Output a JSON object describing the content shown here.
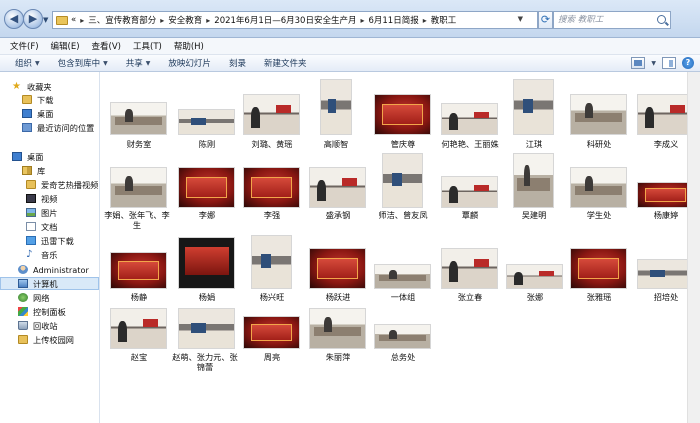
{
  "address": {
    "crumbs": [
      "«",
      "三、宣传教育部分",
      "安全教育",
      "2021年6月1日—6月30日安全生产月",
      "6月11日简报",
      "教职工"
    ]
  },
  "search": {
    "placeholder": "搜索 教职工"
  },
  "menu": [
    "文件(F)",
    "编辑(E)",
    "查看(V)",
    "工具(T)",
    "帮助(H)"
  ],
  "toolbar": {
    "organize": "组织",
    "include": "包含到库中",
    "share": "共享",
    "slideshow": "放映幻灯片",
    "burn": "刻录",
    "new_folder": "新建文件夹"
  },
  "nav": [
    {
      "label": "收藏夹",
      "icon": "star-icon"
    },
    {
      "label": "下载",
      "icon": "folder-icon"
    },
    {
      "label": "桌面",
      "icon": "desktop-icon"
    },
    {
      "label": "最近访问的位置",
      "icon": "recent-icon"
    },
    {
      "label": "桌面",
      "icon": "desktop-icon"
    },
    {
      "label": "库",
      "icon": "library-icon"
    },
    {
      "label": "爱奇艺热播视频",
      "icon": "folder-icon"
    },
    {
      "label": "视频",
      "icon": "video-icon"
    },
    {
      "label": "图片",
      "icon": "picture-icon"
    },
    {
      "label": "文档",
      "icon": "document-icon"
    },
    {
      "label": "迅雷下载",
      "icon": "download-icon"
    },
    {
      "label": "音乐",
      "icon": "music-icon"
    },
    {
      "label": "Administrator",
      "icon": "user-icon"
    },
    {
      "label": "计算机",
      "icon": "computer-icon"
    },
    {
      "label": "网络",
      "icon": "network-icon"
    },
    {
      "label": "控制面板",
      "icon": "control-panel-icon"
    },
    {
      "label": "回收站",
      "icon": "recycle-bin-icon"
    },
    {
      "label": "上传校园网",
      "icon": "folder-icon"
    }
  ],
  "thumbnails": [
    "财务室",
    "陈刚",
    "刘璐、黄瑶",
    "高顺智",
    "管庆尊",
    "何艳艳、王丽姝",
    "江琪",
    "科研处",
    "李成义",
    "李娟、张年飞、李生",
    "李娜",
    "李强",
    "盛承钢",
    "师洁、曾友凤",
    "覃麟",
    "吴建明",
    "学生处",
    "杨康婷",
    "杨静",
    "杨娟",
    "杨兴旺",
    "杨跃进",
    "一体组",
    "张立春",
    "张娜",
    "张雅瑶",
    "招培处",
    "赵宝",
    "赵萌、张力元、张锦蕾",
    "周亮",
    "朱丽萍",
    "总务处"
  ]
}
